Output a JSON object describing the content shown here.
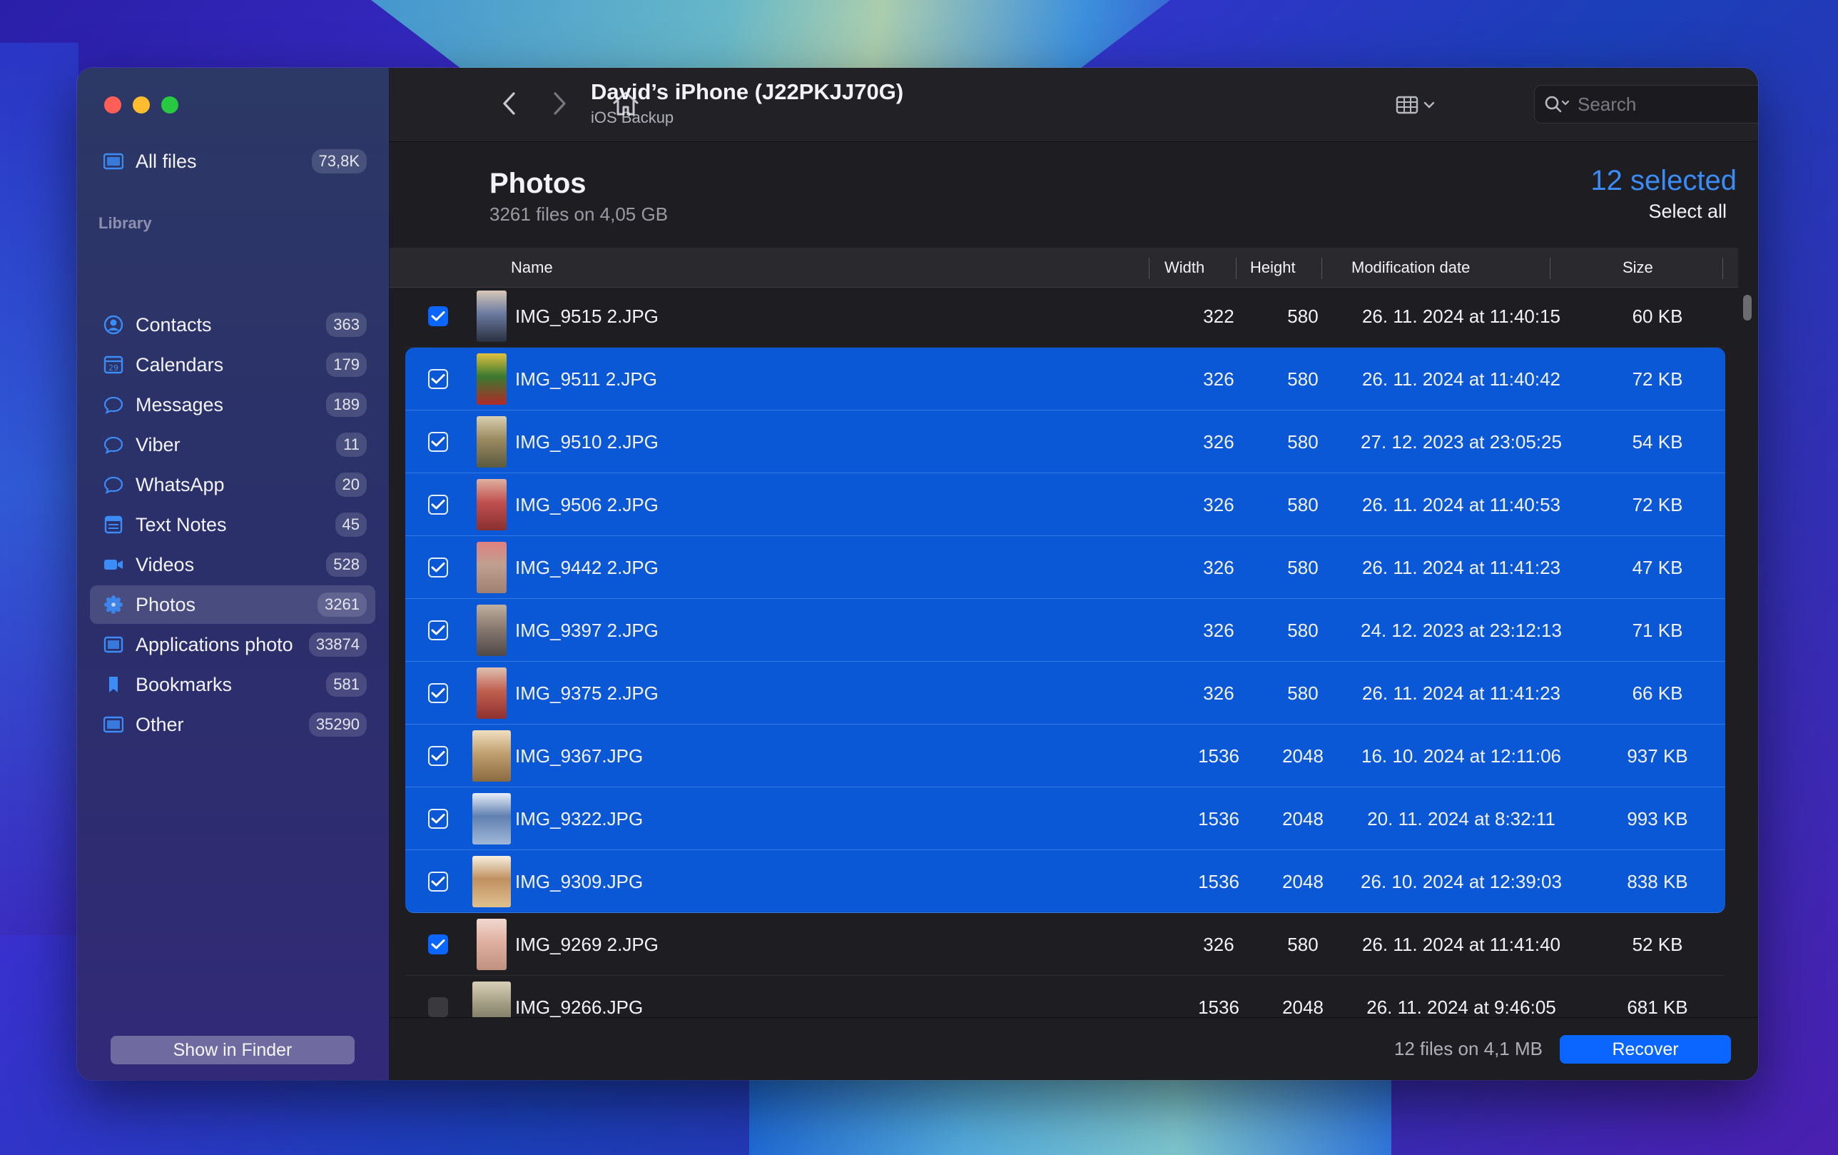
{
  "sidebar": {
    "all_files": {
      "label": "All files",
      "count": "73,8K"
    },
    "library_heading": "Library",
    "items": [
      {
        "label": "Contacts",
        "count": "363",
        "icon": "person-circle-icon"
      },
      {
        "label": "Calendars",
        "count": "179",
        "icon": "calendar-icon"
      },
      {
        "label": "Messages",
        "count": "189",
        "icon": "message-bubble-icon"
      },
      {
        "label": "Viber",
        "count": "11",
        "icon": "message-bubble-icon"
      },
      {
        "label": "WhatsApp",
        "count": "20",
        "icon": "message-bubble-icon"
      },
      {
        "label": "Text Notes",
        "count": "45",
        "icon": "note-icon"
      },
      {
        "label": "Videos",
        "count": "528",
        "icon": "video-camera-icon"
      },
      {
        "label": "Photos",
        "count": "3261",
        "icon": "flower-icon"
      },
      {
        "label": "Applications photo",
        "count": "33874",
        "icon": "photo-frame-icon"
      },
      {
        "label": "Bookmarks",
        "count": "581",
        "icon": "bookmark-icon"
      },
      {
        "label": "Other",
        "count": "35290",
        "icon": "folder-icon"
      }
    ],
    "show_in_finder": "Show in Finder"
  },
  "toolbar": {
    "title": "David’s iPhone (J22PKJJ70G)",
    "subtitle": "iOS Backup",
    "search_placeholder": "Search"
  },
  "section": {
    "title": "Photos",
    "subtitle": "3261 files on 4,05 GB",
    "selected": "12 selected",
    "select_all": "Select all"
  },
  "table": {
    "columns": [
      "Name",
      "Width",
      "Height",
      "Modification date",
      "Size"
    ],
    "rows": [
      {
        "name": "IMG_9515 2.JPG",
        "width": "322",
        "height": "580",
        "date": "26. 11. 2024 at 11:40:15",
        "size": "60 KB",
        "checked": true,
        "selected": false
      },
      {
        "name": "IMG_9511 2.JPG",
        "width": "326",
        "height": "580",
        "date": "26. 11. 2024 at 11:40:42",
        "size": "72 KB",
        "checked": true,
        "selected": true
      },
      {
        "name": "IMG_9510 2.JPG",
        "width": "326",
        "height": "580",
        "date": "27. 12. 2023 at 23:05:25",
        "size": "54 KB",
        "checked": true,
        "selected": true
      },
      {
        "name": "IMG_9506 2.JPG",
        "width": "326",
        "height": "580",
        "date": "26. 11. 2024 at 11:40:53",
        "size": "72 KB",
        "checked": true,
        "selected": true
      },
      {
        "name": "IMG_9442 2.JPG",
        "width": "326",
        "height": "580",
        "date": "26. 11. 2024 at 11:41:23",
        "size": "47 KB",
        "checked": true,
        "selected": true
      },
      {
        "name": "IMG_9397 2.JPG",
        "width": "326",
        "height": "580",
        "date": "24. 12. 2023 at 23:12:13",
        "size": "71 KB",
        "checked": true,
        "selected": true
      },
      {
        "name": "IMG_9375 2.JPG",
        "width": "326",
        "height": "580",
        "date": "26. 11. 2024 at 11:41:23",
        "size": "66 KB",
        "checked": true,
        "selected": true
      },
      {
        "name": "IMG_9367.JPG",
        "width": "1536",
        "height": "2048",
        "date": "16. 10. 2024 at 12:11:06",
        "size": "937 KB",
        "checked": true,
        "selected": true
      },
      {
        "name": "IMG_9322.JPG",
        "width": "1536",
        "height": "2048",
        "date": "20. 11. 2024 at 8:32:11",
        "size": "993 KB",
        "checked": true,
        "selected": true
      },
      {
        "name": "IMG_9309.JPG",
        "width": "1536",
        "height": "2048",
        "date": "26. 10. 2024 at 12:39:03",
        "size": "838 KB",
        "checked": true,
        "selected": true
      },
      {
        "name": "IMG_9269 2.JPG",
        "width": "326",
        "height": "580",
        "date": "26. 11. 2024 at 11:41:40",
        "size": "52 KB",
        "checked": true,
        "selected": false
      },
      {
        "name": "IMG_9266.JPG",
        "width": "1536",
        "height": "2048",
        "date": "26. 11. 2024 at 9:46:05",
        "size": "681 KB",
        "checked": false,
        "selected": false
      }
    ]
  },
  "footer": {
    "info": "12 files on 4,1 MB",
    "recover": "Recover"
  },
  "colors": {
    "accent": "#0a66ff",
    "selection": "#0a58d6",
    "selected_text": "#3b8cf7"
  }
}
